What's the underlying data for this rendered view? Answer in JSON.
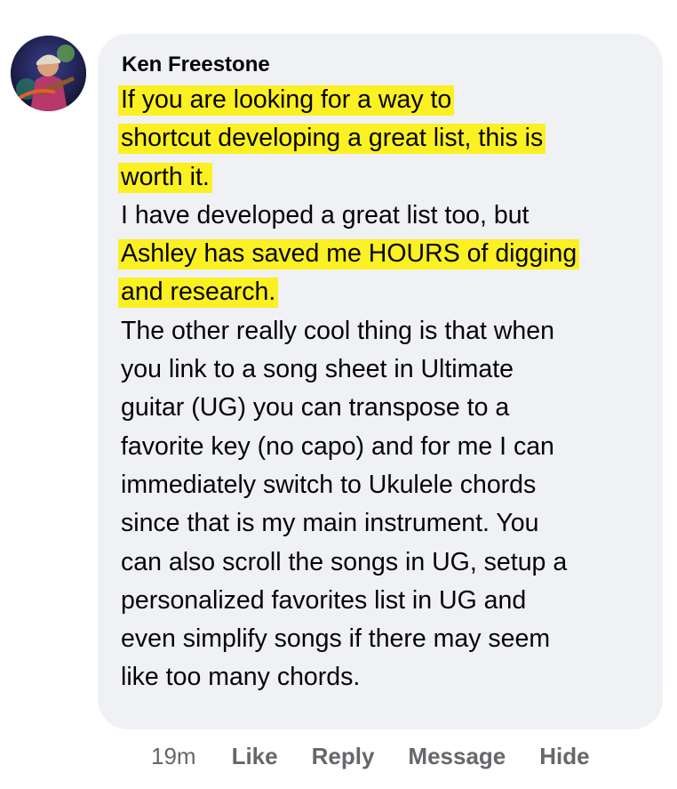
{
  "comment": {
    "author": "Ken Freestone",
    "lines": [
      {
        "text": "If you are looking for a way to",
        "highlight": true
      },
      {
        "text": "shortcut developing a great list, this is",
        "highlight": true
      },
      {
        "text": "worth it.",
        "highlight": true
      },
      {
        "text": "I have developed a great list too, but",
        "highlight": false
      },
      {
        "text": "Ashley has saved me HOURS of digging",
        "highlight": true
      },
      {
        "text": "and research.",
        "highlight": true
      },
      {
        "text": "The other really cool thing is that when",
        "highlight": false
      },
      {
        "text": "you link to a song sheet in Ultimate",
        "highlight": false
      },
      {
        "text": "guitar (UG) you can transpose to a",
        "highlight": false
      },
      {
        "text": "favorite key (no capo) and for me I can",
        "highlight": false
      },
      {
        "text": "immediately switch to Ukulele chords",
        "highlight": false
      },
      {
        "text": "since that is my main instrument. You",
        "highlight": false
      },
      {
        "text": "can also scroll the songs in UG, setup a",
        "highlight": false
      },
      {
        "text": "personalized favorites list in UG and",
        "highlight": false
      },
      {
        "text": "even simplify songs  if there may seem",
        "highlight": false
      },
      {
        "text": "like too many chords.",
        "highlight": false
      }
    ],
    "highlight_color": "#fbf022",
    "bubble_color": "#f0f1f4"
  },
  "actions": {
    "timestamp": "19m",
    "like_label": "Like",
    "reply_label": "Reply",
    "message_label": "Message",
    "hide_label": "Hide"
  }
}
